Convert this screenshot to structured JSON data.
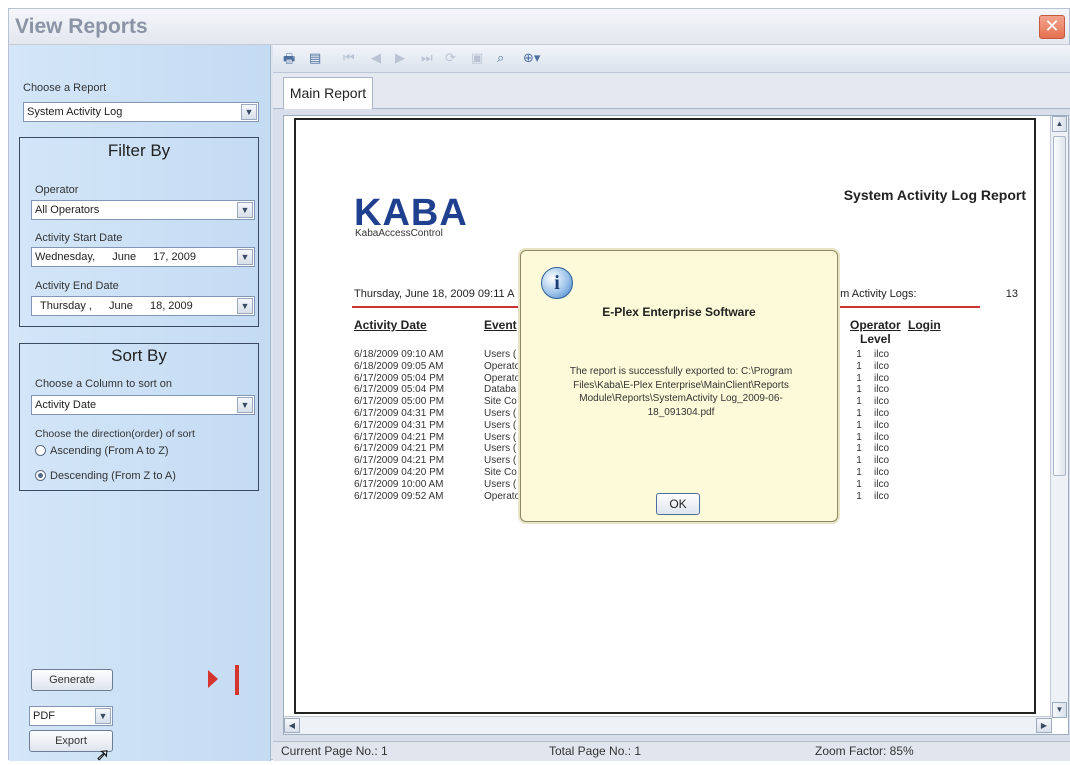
{
  "window": {
    "title": "View Reports"
  },
  "left": {
    "choose_report_label": "Choose a Report",
    "report_value": "System Activity Log",
    "filter_title": "Filter By",
    "operator_label": "Operator",
    "operator_value": "All Operators",
    "start_label": "Activity Start Date",
    "start_day": "Wednesday,",
    "start_month": "June",
    "start_date": "17, 2009",
    "end_label": "Activity End Date",
    "end_day": "Thursday ,",
    "end_month": "June",
    "end_date": "18, 2009",
    "sort_title": "Sort By",
    "sort_column_label": "Choose a Column to sort on",
    "sort_column_value": "Activity Date",
    "direction_label": "Choose the direction(order) of sort",
    "ascending": "Ascending (From A to Z)",
    "descending": "Descending (From Z to A)",
    "generate_label": "Generate",
    "format_value": "PDF",
    "export_label": "Export"
  },
  "toolbar": {
    "icons": [
      "print-icon",
      "tree-icon",
      "first-page-icon",
      "prev-page-icon",
      "next-page-icon",
      "last-page-icon",
      "refresh-icon",
      "stop-icon",
      "binoculars-icon",
      "zoom-icon"
    ]
  },
  "tabs": {
    "main": "Main Report"
  },
  "report": {
    "logo": "KABA",
    "logo_sub": "KabaAccessControl",
    "title": "System Activity Log Report",
    "date_line": "Thursday, June 18, 2009 09:11 A",
    "logs_label": "em Activity Logs:",
    "logs_count": "13",
    "columns": {
      "date": "Activity Date",
      "event": "Event",
      "operator": "Operator",
      "level": "Level",
      "login": "Login"
    },
    "rows": [
      {
        "date": "6/18/2009  09:10 AM",
        "event": "Users (",
        "level": "1",
        "login": "ilco"
      },
      {
        "date": "6/18/2009  09:05 AM",
        "event": "Operato",
        "level": "1",
        "login": "ilco"
      },
      {
        "date": "6/17/2009  05:04 PM",
        "event": "Operato",
        "level": "1",
        "login": "ilco"
      },
      {
        "date": "6/17/2009  05:04 PM",
        "event": "Databa",
        "level": "1",
        "login": "ilco"
      },
      {
        "date": "6/17/2009  05:00 PM",
        "event": "Site Co",
        "level": "1",
        "login": "ilco"
      },
      {
        "date": "6/17/2009  04:31 PM",
        "event": "Users (",
        "level": "1",
        "login": "ilco"
      },
      {
        "date": "6/17/2009  04:31 PM",
        "event": "Users (",
        "level": "1",
        "login": "ilco"
      },
      {
        "date": "6/17/2009  04:21 PM",
        "event": "Users (",
        "level": "1",
        "login": "ilco"
      },
      {
        "date": "6/17/2009  04:21 PM",
        "event": "Users (",
        "level": "1",
        "login": "ilco"
      },
      {
        "date": "6/17/2009  04:21 PM",
        "event": "Users (",
        "level": "1",
        "login": "ilco"
      },
      {
        "date": "6/17/2009  04:20 PM",
        "event": "Site Co",
        "level": "1",
        "login": "ilco"
      },
      {
        "date": "6/17/2009  10:00 AM",
        "event": "Users (",
        "level": "1",
        "login": "ilco"
      },
      {
        "date": "6/17/2009  09:52 AM",
        "event": "Operato",
        "level": "1",
        "login": "ilco"
      }
    ]
  },
  "status": {
    "current_page": "Current Page No.:  1",
    "total_page": "Total Page No.:  1",
    "zoom": "Zoom Factor:  85%"
  },
  "dialog": {
    "heading": "E-Plex Enterprise Software",
    "message": "The report is successfully exported to: C:\\Program Files\\Kaba\\E-Plex Enterprise\\MainClient\\Reports Module\\Reports\\SystemActivity Log_2009-06-18_091304.pdf",
    "ok": "OK"
  },
  "colors": {
    "accent": "#1f3f8f",
    "dialog_bg": "#fcfad8",
    "rule": "#cc3333"
  }
}
